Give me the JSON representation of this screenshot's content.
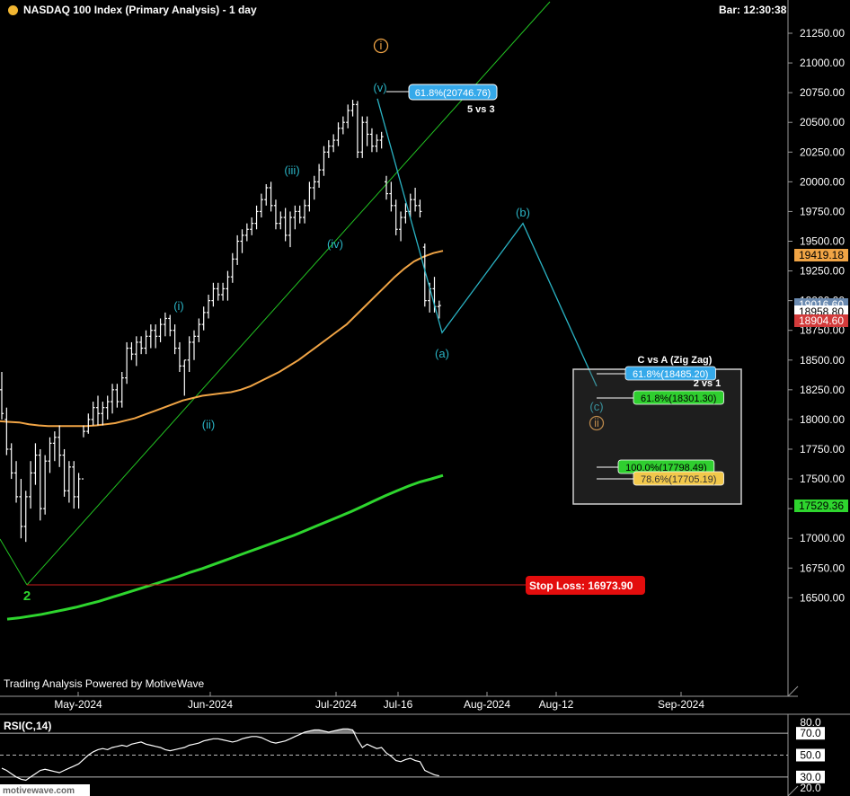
{
  "header": {
    "title": "NASDAQ 100 Index (Primary Analysis) - 1 day",
    "bar_time": "Bar: 12:30:38"
  },
  "credit": "Trading Analysis Powered by MotiveWave",
  "watermark": "motivewave.com",
  "colors": {
    "background": "#000000",
    "price_bar": "#ffffff",
    "sma_orange": "#f0a445",
    "sma_green": "#2ed52e",
    "wave_cyan": "#2ab3c4",
    "trend_line": "#22c322",
    "stop_loss": "#e30d0d",
    "fib_blue": "#35a9ea",
    "fib_green": "#2fcf2f",
    "fib_yellow": "#f2c84b"
  },
  "chart_data": [
    {
      "type": "line",
      "title": "NASDAQ 100 Index (Primary Analysis) - 1 day",
      "x_tick_labels": [
        "May-2024",
        "Jun-2024",
        "Jul-2024",
        "Jul-16",
        "Aug-2024",
        "Aug-12",
        "Sep-2024"
      ],
      "y_tick_labels": [
        "21250.00",
        "21000.00",
        "20750.00",
        "20500.00",
        "20250.00",
        "20000.00",
        "19750.00",
        "19500.00",
        "19250.00",
        "19000.00",
        "18750.00",
        "18500.00",
        "18250.00",
        "18000.00",
        "17750.00",
        "17500.00",
        "17250.00",
        "17000.00",
        "16750.00",
        "16500.00"
      ],
      "ylim": [
        16300,
        21500
      ],
      "price_tags": [
        {
          "value": 19419.18,
          "label": "19419.18",
          "color": "#f0a445"
        },
        {
          "value": 19016.6,
          "label": "19016.60",
          "color": "#6a8ab0"
        },
        {
          "value": 18958.8,
          "label": "18958.80",
          "color": "#ffffff"
        },
        {
          "value": 18904.6,
          "label": "18904.60",
          "color": "#d23b3b"
        },
        {
          "value": 17529.36,
          "label": "17529.36",
          "color": "#2ed52e"
        }
      ],
      "ohlc": [
        {
          "o": 18250,
          "h": 18400,
          "l": 18000,
          "c": 18050
        },
        {
          "o": 18000,
          "h": 18100,
          "l": 17700,
          "c": 17750
        },
        {
          "o": 17750,
          "h": 17800,
          "l": 17500,
          "c": 17550
        },
        {
          "o": 17550,
          "h": 17650,
          "l": 17300,
          "c": 17350
        },
        {
          "o": 17350,
          "h": 17500,
          "l": 17000,
          "c": 17100
        },
        {
          "o": 17100,
          "h": 17400,
          "l": 16970,
          "c": 17350
        },
        {
          "o": 17350,
          "h": 17650,
          "l": 17250,
          "c": 17550
        },
        {
          "o": 17550,
          "h": 17800,
          "l": 17450,
          "c": 17700
        },
        {
          "o": 17700,
          "h": 17750,
          "l": 17150,
          "c": 17250
        },
        {
          "o": 17250,
          "h": 17700,
          "l": 17200,
          "c": 17650
        },
        {
          "o": 17650,
          "h": 17850,
          "l": 17550,
          "c": 17800
        },
        {
          "o": 17800,
          "h": 17900,
          "l": 17650,
          "c": 17850
        },
        {
          "o": 17850,
          "h": 17950,
          "l": 17600,
          "c": 17700
        },
        {
          "o": 17700,
          "h": 17750,
          "l": 17350,
          "c": 17400
        },
        {
          "o": 17400,
          "h": 17650,
          "l": 17300,
          "c": 17600
        },
        {
          "o": 17600,
          "h": 17650,
          "l": 17250,
          "c": 17350
        },
        {
          "o": 17350,
          "h": 17550,
          "l": 17250,
          "c": 17500
        },
        {
          "o": 17500,
          "h": 17950,
          "l": 17850,
          "c": 17900
        },
        {
          "o": 17900,
          "h": 18050,
          "l": 17880,
          "c": 18000
        },
        {
          "o": 18000,
          "h": 18150,
          "l": 17950,
          "c": 18100
        },
        {
          "o": 18100,
          "h": 18200,
          "l": 17950,
          "c": 18050
        },
        {
          "o": 18050,
          "h": 18150,
          "l": 17950,
          "c": 18100
        },
        {
          "o": 18100,
          "h": 18200,
          "l": 18000,
          "c": 18150
        },
        {
          "o": 18150,
          "h": 18300,
          "l": 18050,
          "c": 18250
        },
        {
          "o": 18250,
          "h": 18300,
          "l": 18100,
          "c": 18150
        },
        {
          "o": 18150,
          "h": 18400,
          "l": 18100,
          "c": 18350
        },
        {
          "o": 18350,
          "h": 18650,
          "l": 18300,
          "c": 18600
        },
        {
          "o": 18600,
          "h": 18650,
          "l": 18500,
          "c": 18550
        },
        {
          "o": 18550,
          "h": 18700,
          "l": 18450,
          "c": 18650
        },
        {
          "o": 18650,
          "h": 18700,
          "l": 18550,
          "c": 18600
        },
        {
          "o": 18600,
          "h": 18750,
          "l": 18550,
          "c": 18700
        },
        {
          "o": 18700,
          "h": 18800,
          "l": 18600,
          "c": 18750
        },
        {
          "o": 18750,
          "h": 18800,
          "l": 18600,
          "c": 18700
        },
        {
          "o": 18700,
          "h": 18850,
          "l": 18650,
          "c": 18800
        },
        {
          "o": 18800,
          "h": 18900,
          "l": 18700,
          "c": 18850
        },
        {
          "o": 18850,
          "h": 18880,
          "l": 18700,
          "c": 18750
        },
        {
          "o": 18750,
          "h": 18800,
          "l": 18550,
          "c": 18600
        },
        {
          "o": 18600,
          "h": 18650,
          "l": 18400,
          "c": 18450
        },
        {
          "o": 18450,
          "h": 18500,
          "l": 18200,
          "c": 18500
        },
        {
          "o": 18500,
          "h": 18700,
          "l": 18400,
          "c": 18650
        },
        {
          "o": 18650,
          "h": 18750,
          "l": 18500,
          "c": 18700
        },
        {
          "o": 18700,
          "h": 18850,
          "l": 18650,
          "c": 18800
        },
        {
          "o": 18800,
          "h": 18950,
          "l": 18750,
          "c": 18900
        },
        {
          "o": 18900,
          "h": 19050,
          "l": 18850,
          "c": 19000
        },
        {
          "o": 19000,
          "h": 19150,
          "l": 18950,
          "c": 19100
        },
        {
          "o": 19100,
          "h": 19150,
          "l": 19000,
          "c": 19050
        },
        {
          "o": 19050,
          "h": 19150,
          "l": 19000,
          "c": 19100
        },
        {
          "o": 19100,
          "h": 19250,
          "l": 19000,
          "c": 19200
        },
        {
          "o": 19200,
          "h": 19400,
          "l": 19150,
          "c": 19350
        },
        {
          "o": 19350,
          "h": 19550,
          "l": 19300,
          "c": 19500
        },
        {
          "o": 19500,
          "h": 19600,
          "l": 19400,
          "c": 19550
        },
        {
          "o": 19550,
          "h": 19650,
          "l": 19500,
          "c": 19600
        },
        {
          "o": 19600,
          "h": 19700,
          "l": 19550,
          "c": 19650
        },
        {
          "o": 19650,
          "h": 19800,
          "l": 19600,
          "c": 19750
        },
        {
          "o": 19750,
          "h": 19900,
          "l": 19700,
          "c": 19850
        },
        {
          "o": 19850,
          "h": 19980,
          "l": 19800,
          "c": 19950
        },
        {
          "o": 19950,
          "h": 20000,
          "l": 19750,
          "c": 19800
        },
        {
          "o": 19800,
          "h": 19850,
          "l": 19600,
          "c": 19650
        },
        {
          "o": 19650,
          "h": 19750,
          "l": 19600,
          "c": 19700
        },
        {
          "o": 19700,
          "h": 19780,
          "l": 19500,
          "c": 19550
        },
        {
          "o": 19550,
          "h": 19750,
          "l": 19450,
          "c": 19700
        },
        {
          "o": 19700,
          "h": 19800,
          "l": 19600,
          "c": 19750
        },
        {
          "o": 19750,
          "h": 19800,
          "l": 19650,
          "c": 19700
        },
        {
          "o": 19700,
          "h": 19850,
          "l": 19650,
          "c": 19800
        },
        {
          "o": 19800,
          "h": 20000,
          "l": 19750,
          "c": 19950
        },
        {
          "o": 19950,
          "h": 20050,
          "l": 19850,
          "c": 20000
        },
        {
          "o": 20000,
          "h": 20150,
          "l": 19950,
          "c": 20100
        },
        {
          "o": 20100,
          "h": 20300,
          "l": 20050,
          "c": 20250
        },
        {
          "o": 20250,
          "h": 20350,
          "l": 20200,
          "c": 20300
        },
        {
          "o": 20300,
          "h": 20400,
          "l": 20250,
          "c": 20350
        },
        {
          "o": 20350,
          "h": 20500,
          "l": 20300,
          "c": 20450
        },
        {
          "o": 20450,
          "h": 20550,
          "l": 20400,
          "c": 20500
        },
        {
          "o": 20500,
          "h": 20650,
          "l": 20450,
          "c": 20600
        },
        {
          "o": 20600,
          "h": 20690,
          "l": 20550,
          "c": 20650
        },
        {
          "o": 20650,
          "h": 20680,
          "l": 20200,
          "c": 20250
        },
        {
          "o": 20250,
          "h": 20550,
          "l": 20200,
          "c": 20500
        },
        {
          "o": 20500,
          "h": 20550,
          "l": 20300,
          "c": 20400
        },
        {
          "o": 20400,
          "h": 20450,
          "l": 20250,
          "c": 20300
        },
        {
          "o": 20300,
          "h": 20400,
          "l": 20250,
          "c": 20350
        },
        {
          "o": 20350,
          "h": 20420,
          "l": 20280,
          "c": 20380
        },
        {
          "o": 20000,
          "h": 20050,
          "l": 19850,
          "c": 19900
        },
        {
          "o": 19900,
          "h": 20000,
          "l": 19750,
          "c": 19800
        },
        {
          "o": 19800,
          "h": 19850,
          "l": 19550,
          "c": 19600
        },
        {
          "o": 19600,
          "h": 19750,
          "l": 19500,
          "c": 19700
        },
        {
          "o": 19700,
          "h": 19820,
          "l": 19650,
          "c": 19750
        },
        {
          "o": 19750,
          "h": 19900,
          "l": 19700,
          "c": 19850
        },
        {
          "o": 19850,
          "h": 19950,
          "l": 19750,
          "c": 19800
        },
        {
          "o": 19800,
          "h": 19850,
          "l": 19700,
          "c": 19750
        },
        {
          "o": 19450,
          "h": 19480,
          "l": 18950,
          "c": 19000
        },
        {
          "o": 19000,
          "h": 19150,
          "l": 18900,
          "c": 19100
        },
        {
          "o": 19100,
          "h": 19200,
          "l": 18900,
          "c": 18950
        },
        {
          "o": 18950,
          "h": 19000,
          "l": 18850,
          "c": 18958.8
        }
      ],
      "sma_orange": [
        17985,
        17980,
        17975,
        17960,
        17950,
        17945,
        17945,
        17945,
        17945,
        17945,
        17950,
        17960,
        17970,
        17990,
        18010,
        18040,
        18070,
        18100,
        18130,
        18160,
        18180,
        18200,
        18210,
        18220,
        18230,
        18250,
        18280,
        18320,
        18360,
        18400,
        18450,
        18500,
        18560,
        18620,
        18680,
        18740,
        18800,
        18880,
        18960,
        19040,
        19120,
        19200,
        19270,
        19330,
        19370,
        19400,
        19419.18
      ],
      "sma_green": [
        16320,
        16330,
        16345,
        16360,
        16380,
        16400,
        16420,
        16445,
        16470,
        16500,
        16530,
        16560,
        16590,
        16620,
        16650,
        16680,
        16715,
        16745,
        16780,
        16815,
        16850,
        16885,
        16920,
        16955,
        16990,
        17025,
        17065,
        17105,
        17145,
        17185,
        17225,
        17270,
        17315,
        17360,
        17400,
        17440,
        17475,
        17500,
        17529.36
      ],
      "wave_labels": [
        {
          "text": "2",
          "color": "#2ed52e",
          "bold": true
        },
        {
          "text": "(i)",
          "color": "#2ab3c4"
        },
        {
          "text": "(ii)",
          "color": "#2ab3c4"
        },
        {
          "text": "(iii)",
          "color": "#2ab3c4"
        },
        {
          "text": "(iv)",
          "color": "#2ab3c4"
        },
        {
          "text": "(v)",
          "color": "#2ab3c4"
        },
        {
          "text": "i",
          "color": "#f0a445",
          "circled": true
        },
        {
          "text": "(a)",
          "color": "#2ab3c4"
        },
        {
          "text": "(b)",
          "color": "#2ab3c4"
        },
        {
          "text": "(c)",
          "color": "#2ab3c4"
        },
        {
          "text": "ii",
          "color": "#f0a445",
          "circled": true
        }
      ],
      "projection_path": [
        20700,
        18730,
        19650,
        18280
      ],
      "annotations": {
        "fib_top": "61.8%(20746.76)",
        "fib_top_note": "5 vs 3",
        "stop_loss_label": "Stop Loss:",
        "stop_loss_value": "16973.90",
        "box_title": "C vs A (Zig Zag)",
        "box_note": "2 vs 1",
        "fib_box": [
          {
            "label": "61.8%(18485.20)",
            "value": 18485.2,
            "color": "#35a9ea"
          },
          {
            "label": "61.8%(18301.30)",
            "value": 18301.3,
            "color": "#2fcf2f"
          },
          {
            "label": "100.0%(17798.49)",
            "value": 17798.49,
            "color": "#2fcf2f"
          },
          {
            "label": "78.6%(17705.19)",
            "value": 17705.19,
            "color": "#f2c84b"
          }
        ]
      }
    },
    {
      "type": "line",
      "title": "RSI(C,14)",
      "ylim": [
        20,
        80
      ],
      "y_tick_labels": [
        "80.0",
        "70.0",
        "50.0",
        "30.0",
        "20.0"
      ],
      "levels": [
        70,
        50,
        30
      ],
      "values": [
        38,
        36,
        33,
        30,
        28,
        27,
        30,
        33,
        36,
        37,
        36,
        35,
        34,
        36,
        38,
        40,
        42,
        46,
        50,
        53,
        55,
        56,
        55,
        57,
        58,
        59,
        58,
        60,
        61,
        62,
        60,
        59,
        58,
        57,
        55,
        54,
        55,
        56,
        57,
        59,
        60,
        61,
        63,
        64,
        65,
        65,
        64,
        63,
        62,
        63,
        65,
        66,
        67,
        67,
        66,
        64,
        62,
        61,
        62,
        63,
        65,
        67,
        69,
        71,
        72,
        73,
        73,
        72,
        71,
        72,
        73,
        74,
        74,
        73,
        64,
        57,
        60,
        58,
        56,
        57,
        52,
        49,
        45,
        44,
        46,
        47,
        45,
        44,
        36,
        34,
        32,
        31
      ]
    }
  ]
}
